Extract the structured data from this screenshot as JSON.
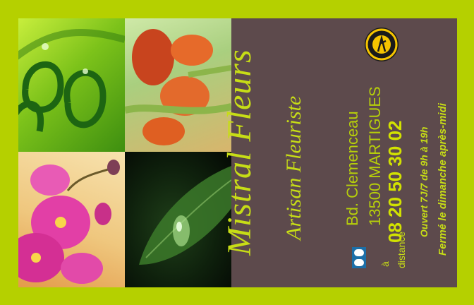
{
  "brand": {
    "name": "Mistral Fleurs",
    "tagline": "Artisan Fleuriste"
  },
  "address": {
    "street": "Bd. Clemenceau",
    "city": "13500 MARTIGUES"
  },
  "phone": {
    "number": "08 20 50 30 02",
    "label_a": "à",
    "label_b": "distance"
  },
  "hours": {
    "open": "Ouvert 7J/7 de 9h à 19h",
    "closed": "Fermé le dimanche après-midi"
  },
  "colors": {
    "background": "#b5d000",
    "panel": "#5d4a4c",
    "accent": "#c7dd16"
  },
  "icons": {
    "seal": "florist-seal-icon",
    "phone": "phone-icon"
  }
}
